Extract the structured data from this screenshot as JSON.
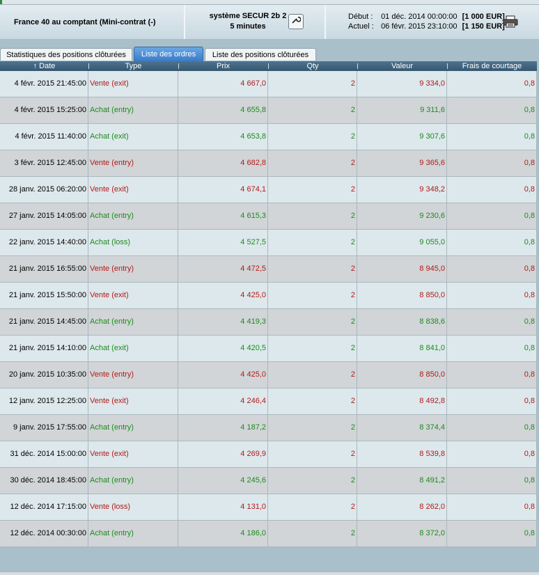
{
  "header": {
    "instrument": "France 40 au comptant (Mini-contrat  (-)",
    "system_name": "système SECUR 2b 2",
    "timeframe": "5 minutes",
    "start_label": "Début :",
    "start_date": "01 déc. 2014 00:00:00",
    "start_value": "[1 000 EUR]",
    "current_label": "Actuel :",
    "current_date": "06 févr. 2015 23:10:00",
    "current_value": "[1 150 EUR]",
    "icons": [
      "wrench-icon",
      "printer-icon"
    ]
  },
  "tabs": [
    {
      "label": "Statistiques des positions clôturées"
    },
    {
      "label": "Liste des ordres",
      "active": true
    },
    {
      "label": "Liste des positions clôturées"
    }
  ],
  "table": {
    "columns": [
      "Date",
      "Type",
      "Prix",
      "Qty",
      "Valeur",
      "Frais de courtage"
    ],
    "sort_indicator": "↑",
    "colors": {
      "sell": "#b01a1a",
      "buy": "#1d8a1d"
    },
    "rows": [
      [
        "4 févr. 2015 21:45:00",
        "Vente (exit)",
        "4 667,0",
        "2",
        "9 334,0",
        "0,8"
      ],
      [
        "4 févr. 2015 15:25:00",
        "Achat (entry)",
        "4 655,8",
        "2",
        "9 311,6",
        "0,8"
      ],
      [
        "4 févr. 2015 11:40:00",
        "Achat (exit)",
        "4 653,8",
        "2",
        "9 307,6",
        "0,8"
      ],
      [
        "3 févr. 2015 12:45:00",
        "Vente (entry)",
        "4 682,8",
        "2",
        "9 365,6",
        "0,8"
      ],
      [
        "28 janv. 2015 06:20:00",
        "Vente (exit)",
        "4 674,1",
        "2",
        "9 348,2",
        "0,8"
      ],
      [
        "27 janv. 2015 14:05:00",
        "Achat (entry)",
        "4 615,3",
        "2",
        "9 230,6",
        "0,8"
      ],
      [
        "22 janv. 2015 14:40:00",
        "Achat (loss)",
        "4 527,5",
        "2",
        "9 055,0",
        "0,8"
      ],
      [
        "21 janv. 2015 16:55:00",
        "Vente (entry)",
        "4 472,5",
        "2",
        "8 945,0",
        "0,8"
      ],
      [
        "21 janv. 2015 15:50:00",
        "Vente (exit)",
        "4 425,0",
        "2",
        "8 850,0",
        "0,8"
      ],
      [
        "21 janv. 2015 14:45:00",
        "Achat (entry)",
        "4 419,3",
        "2",
        "8 838,6",
        "0,8"
      ],
      [
        "21 janv. 2015 14:10:00",
        "Achat (exit)",
        "4 420,5",
        "2",
        "8 841,0",
        "0,8"
      ],
      [
        "20 janv. 2015 10:35:00",
        "Vente (entry)",
        "4 425,0",
        "2",
        "8 850,0",
        "0,8"
      ],
      [
        "12 janv. 2015 12:25:00",
        "Vente (exit)",
        "4 246,4",
        "2",
        "8 492,8",
        "0,8"
      ],
      [
        "9 janv. 2015 17:55:00",
        "Achat (entry)",
        "4 187,2",
        "2",
        "8 374,4",
        "0,8"
      ],
      [
        "31 déc. 2014 15:00:00",
        "Vente (exit)",
        "4 269,9",
        "2",
        "8 539,8",
        "0,8"
      ],
      [
        "30 déc. 2014 18:45:00",
        "Achat (entry)",
        "4 245,6",
        "2",
        "8 491,2",
        "0,8"
      ],
      [
        "12 déc. 2014 17:15:00",
        "Vente (loss)",
        "4 131,0",
        "2",
        "8 262,0",
        "0,8"
      ],
      [
        "12 déc. 2014 00:30:00",
        "Achat (entry)",
        "4 186,0",
        "2",
        "8 372,0",
        "0,8"
      ]
    ]
  }
}
